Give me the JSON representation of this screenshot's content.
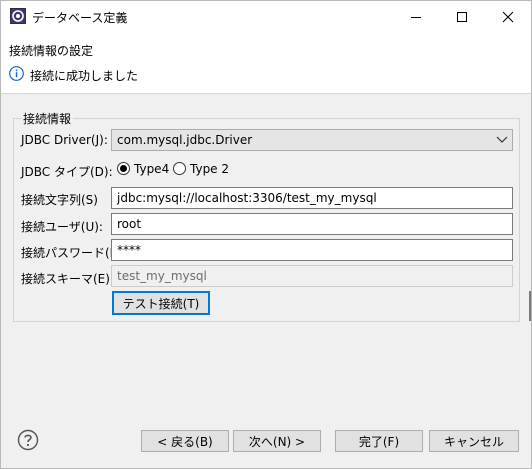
{
  "window": {
    "title": "データベース定義",
    "icon": "database-app-icon"
  },
  "header": {
    "title": "接続情報の設定",
    "message": "接続に成功しました",
    "message_icon": "info-icon"
  },
  "group": {
    "legend": "接続情報",
    "driver": {
      "label": "JDBC Driver(J):",
      "value": "com.mysql.jdbc.Driver"
    },
    "jdbc_type": {
      "label": "JDBC タイプ(D):",
      "options": [
        "Type4",
        "Type 2"
      ],
      "selected": "Type4"
    },
    "url": {
      "label": "接続文字列(S)",
      "value": "jdbc:mysql://localhost:3306/test_my_mysql"
    },
    "user": {
      "label": "接続ユーザ(U):",
      "value": "root"
    },
    "password": {
      "label": "接続パスワード(P):",
      "value": "****"
    },
    "schema": {
      "label": "接続スキーマ(E):",
      "value": "test_my_mysql"
    },
    "test_button": "テスト接続(T)"
  },
  "footer": {
    "back": "< 戻る(B)",
    "next": "次へ(N) >",
    "finish": "完了(F)",
    "cancel": "キャンセル"
  },
  "colors": {
    "accent": "#0078d7",
    "info_blue": "#1a63c9",
    "background": "#f0f0f0"
  }
}
